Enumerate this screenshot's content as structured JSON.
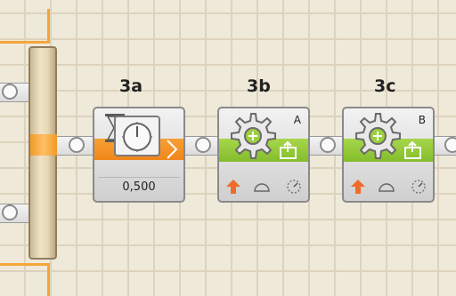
{
  "steps": [
    {
      "id": "3a",
      "label": "3a",
      "type": "wait-timer",
      "value": "0,500"
    },
    {
      "id": "3b",
      "label": "3b",
      "type": "motor",
      "port": "A"
    },
    {
      "id": "3c",
      "label": "3c",
      "type": "motor",
      "port": "B"
    }
  ],
  "colors": {
    "sequence_beam": "#f5a43a",
    "timer_band": "#f0861a",
    "motor_band": "#8cc63f",
    "grid_bg": "#efe9d9"
  },
  "icons": [
    "hourglass-icon",
    "timer-dial-icon",
    "gear-icon",
    "motor-direction-up-icon",
    "power-icon",
    "duration-dial-icon"
  ]
}
